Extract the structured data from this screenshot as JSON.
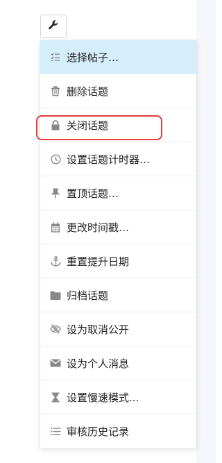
{
  "colors": {
    "selected_bg": "#d4eefb",
    "icon_gray": "#888888",
    "text": "#222222",
    "highlight_red": "#e23b3b"
  },
  "toolbar": {
    "wrench_icon": "wrench-icon"
  },
  "menu": {
    "items": [
      {
        "label": "选择帖子…",
        "icon": "tasks-icon",
        "selected": true
      },
      {
        "label": "删除话题",
        "icon": "trash-icon"
      },
      {
        "label": "关闭话题",
        "icon": "lock-icon",
        "highlighted": true
      },
      {
        "label": "设置话题计时器…",
        "icon": "clock-icon"
      },
      {
        "label": "置顶话题…",
        "icon": "thumbtack-icon"
      },
      {
        "label": "更改时间戳…",
        "icon": "calendar-icon"
      },
      {
        "label": "重置提升日期",
        "icon": "anchor-icon"
      },
      {
        "label": "归档话题",
        "icon": "folder-icon"
      },
      {
        "label": "设为取消公开",
        "icon": "eye-slash-icon"
      },
      {
        "label": "设为个人消息",
        "icon": "envelope-icon"
      },
      {
        "label": "设置慢速模式...",
        "icon": "hourglass-icon"
      },
      {
        "label": "审核历史记录",
        "icon": "list-icon"
      }
    ]
  }
}
